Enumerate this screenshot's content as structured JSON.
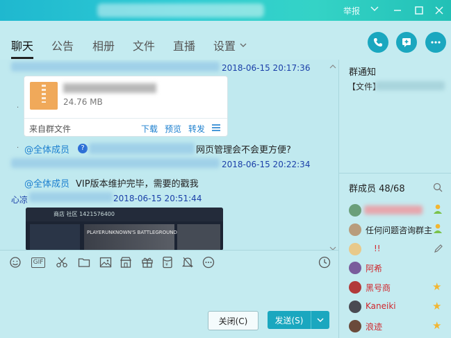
{
  "window": {
    "report_label": "举报",
    "controls": [
      "minimize-icon",
      "maximize-icon",
      "close-icon"
    ]
  },
  "tabs": [
    {
      "label": "聊天",
      "active": true
    },
    {
      "label": "公告",
      "active": false
    },
    {
      "label": "相册",
      "active": false
    },
    {
      "label": "文件",
      "active": false
    },
    {
      "label": "直播",
      "active": false
    },
    {
      "label": "设置",
      "active": false
    }
  ],
  "header_actions": [
    "phone-icon",
    "add-icon",
    "more-icon"
  ],
  "chat": {
    "messages": [
      {
        "timestamp": "2018-06-15 20:17:36",
        "file": {
          "size": "24.76 MB",
          "source": "来自群文件",
          "actions": [
            "下载",
            "预览",
            "转发"
          ]
        }
      },
      {
        "mention": "@全体成员",
        "text_visible": "网页管理会不会更方便?"
      },
      {
        "timestamp": "2018-06-15 20:22:34",
        "mention": "@全体成员",
        "text": "VIP版本维护完毕，需要的戳我"
      },
      {
        "sender_prefix": "心凉",
        "timestamp": "2018-06-15 20:51:44",
        "image_texts": {
          "breadcrumb": "商店  社区  1421576400",
          "game_title": "PLAYERUNKNOWN'S BATTLEGROUNDS"
        }
      }
    ]
  },
  "toolbar": {
    "tools": [
      "emoji-icon",
      "gif-icon",
      "scissors-icon",
      "folder-icon",
      "image-icon",
      "shop-icon",
      "gift-icon",
      "red-packet-icon",
      "bell-icon",
      "more-circle-icon"
    ],
    "gif_label": "GIF",
    "history": "clock-icon"
  },
  "input": {
    "close_label": "关闭(C)",
    "send_label": "发送(S)"
  },
  "right": {
    "notice_title": "群通知",
    "notice_text": "【文件】",
    "members_title": "群成员 48/68",
    "members": [
      {
        "name": "",
        "badge": "admin"
      },
      {
        "name": "任何问题咨询群主",
        "badge": "admin"
      },
      {
        "name": "!!",
        "badge": "edit"
      },
      {
        "name": "阿希",
        "badge": ""
      },
      {
        "name": "黑号商",
        "badge": "star"
      },
      {
        "name": "Kaneiki",
        "badge": "star"
      },
      {
        "name": "浪迹",
        "badge": "star"
      }
    ]
  },
  "colors": {
    "accent": "#1aa7bf",
    "name_red": "#d0262c",
    "timestamp": "#1a3fa8",
    "link": "#1b7fcf"
  }
}
